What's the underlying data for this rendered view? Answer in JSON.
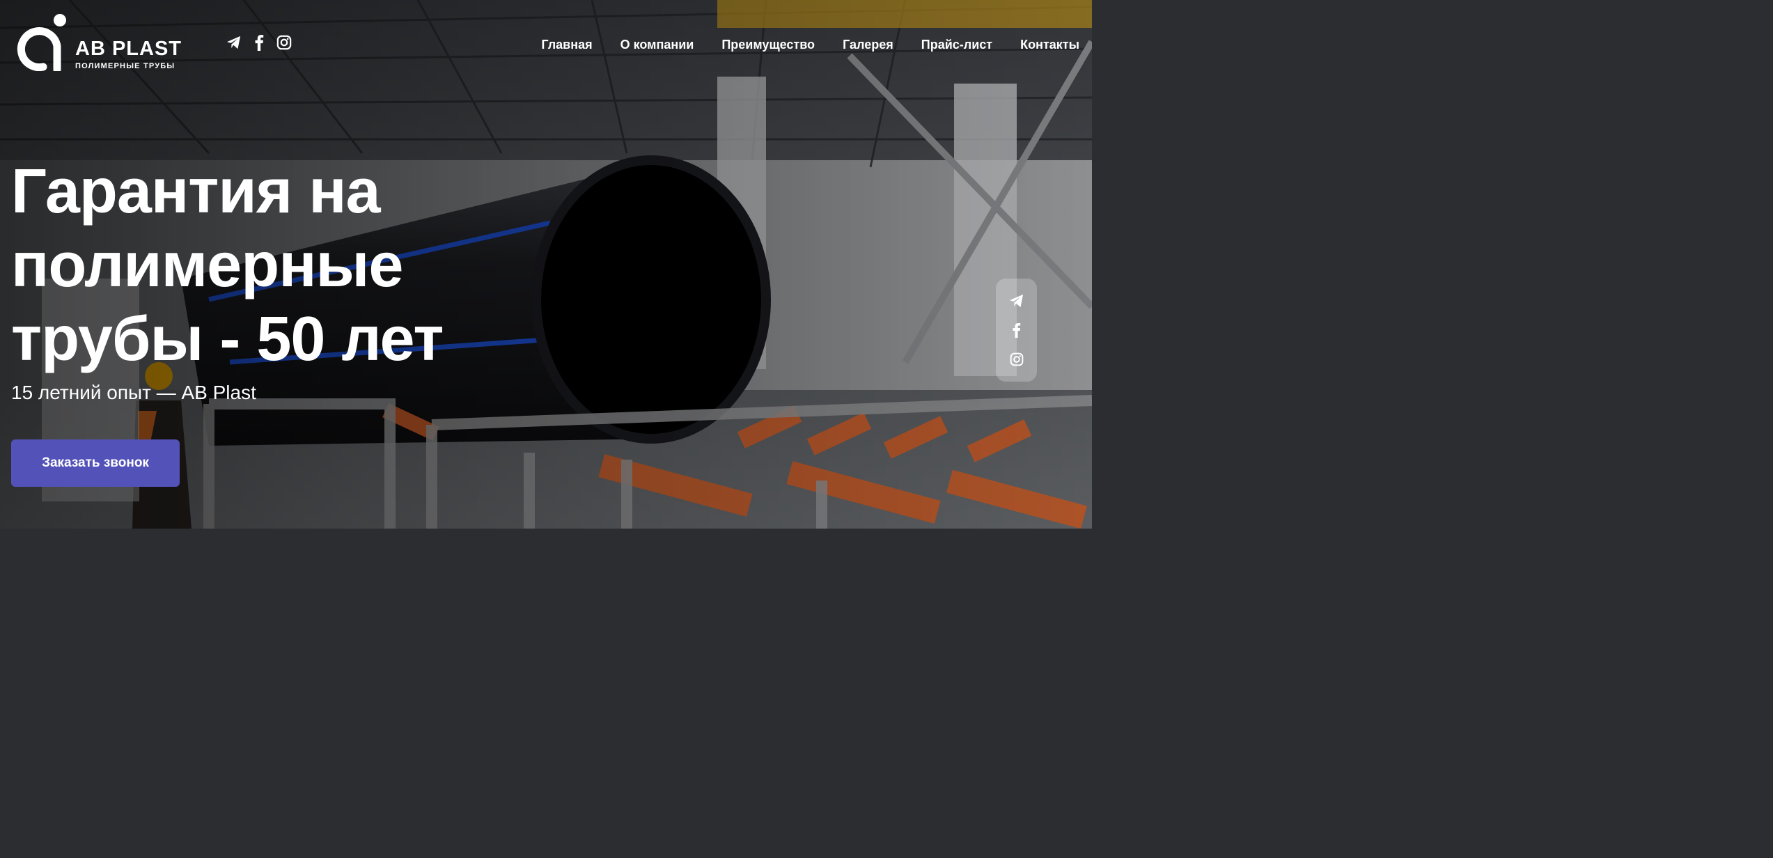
{
  "brand": {
    "name": "AB PLAST",
    "tagline": "ПОЛИМЕРНЫЕ ТРУБЫ"
  },
  "header_social": [
    {
      "icon": "telegram-icon"
    },
    {
      "icon": "facebook-icon"
    },
    {
      "icon": "instagram-icon"
    }
  ],
  "nav": {
    "items": [
      {
        "label": "Главная"
      },
      {
        "label": "О компании"
      },
      {
        "label": "Преимущество"
      },
      {
        "label": "Галерея"
      },
      {
        "label": "Прайс-лист"
      },
      {
        "label": "Контакты"
      }
    ]
  },
  "hero": {
    "title": "Гарантия на полимерные трубы - 50 лет",
    "subtitle": "15 летний опыт — AB Plast",
    "cta_label": "Заказать звонок"
  },
  "side_social": [
    {
      "icon": "telegram-icon"
    },
    {
      "icon": "facebook-icon"
    },
    {
      "icon": "instagram-icon"
    }
  ],
  "colors": {
    "cta_background": "#5352b8",
    "text": "#ffffff",
    "side_panel": "rgba(255,255,255,0.22)"
  }
}
